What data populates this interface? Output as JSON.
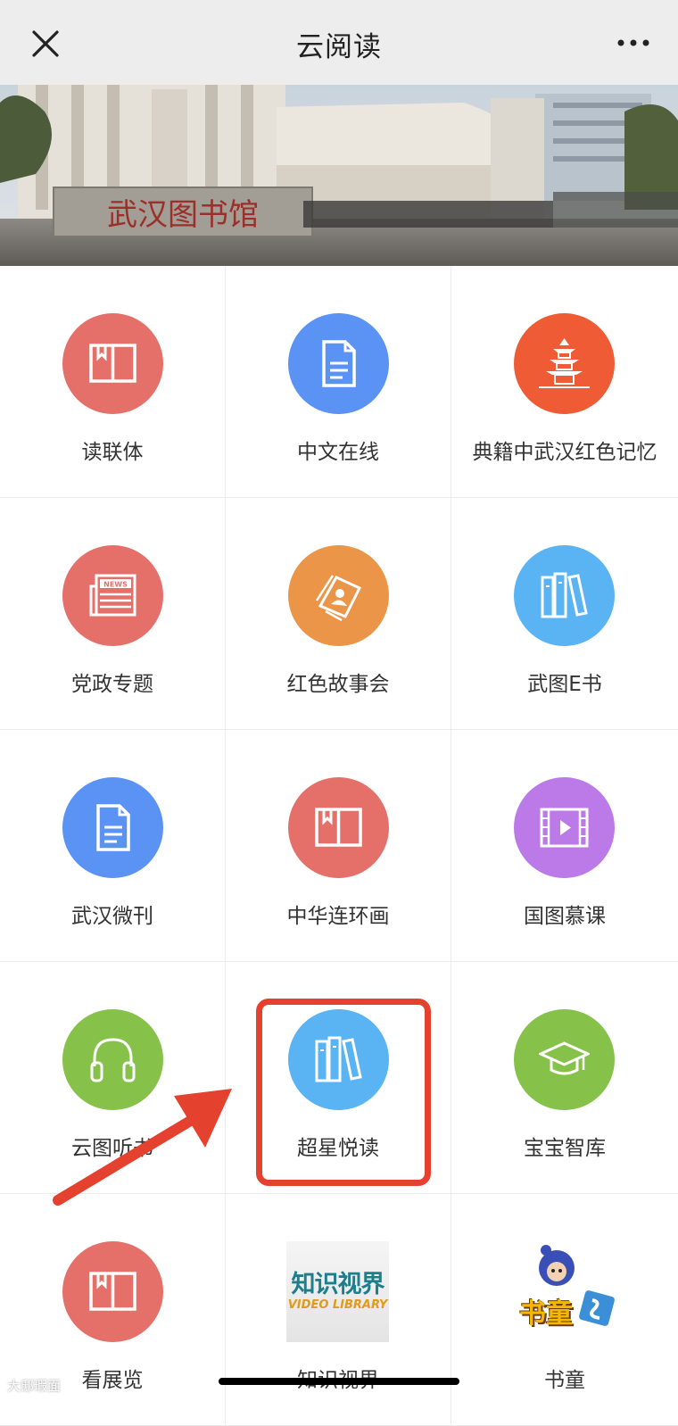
{
  "header": {
    "title": "云阅读",
    "close_icon": "close-icon",
    "more_icon": "more-icon"
  },
  "banner": {
    "sign_text": "武汉图书馆"
  },
  "grid": [
    {
      "label": "读联体",
      "color": "#e5706a",
      "icon": "book-icon"
    },
    {
      "label": "中文在线",
      "color": "#5b93f4",
      "icon": "document-icon"
    },
    {
      "label": "典籍中武汉红色记忆",
      "color": "#ee5b35",
      "icon": "pagoda-icon"
    },
    {
      "label": "党政专题",
      "color": "#e5706a",
      "icon": "news-icon"
    },
    {
      "label": "红色故事会",
      "color": "#eb9548",
      "icon": "stories-icon"
    },
    {
      "label": "武图E书",
      "color": "#5ab3f3",
      "icon": "bookshelf-icon"
    },
    {
      "label": "武汉微刊",
      "color": "#5b93f4",
      "icon": "document-icon"
    },
    {
      "label": "中华连环画",
      "color": "#e5706a",
      "icon": "book-icon"
    },
    {
      "label": "国图慕课",
      "color": "#bc7ae9",
      "icon": "video-icon"
    },
    {
      "label": "云图听书",
      "color": "#86c24a",
      "icon": "headphones-icon"
    },
    {
      "label": "超星悦读",
      "color": "#5ab3f3",
      "icon": "bookshelf-icon"
    },
    {
      "label": "宝宝智库",
      "color": "#86c24a",
      "icon": "graduation-cap-icon"
    },
    {
      "label": "看展览",
      "color": "#e5706a",
      "icon": "book-icon"
    },
    {
      "label": "知识视界",
      "color": "#ffffff",
      "icon": "video-library-logo",
      "logo_text_1": "知识视界",
      "logo_text_2": "VIDEO LIBRARY"
    },
    {
      "label": "书童",
      "color": "#ffffff",
      "icon": "shutong-logo",
      "logo_text": "书童"
    }
  ],
  "highlight": {
    "target": "超星悦读",
    "color": "#e5412f"
  },
  "watermark": "大邸瑕面"
}
